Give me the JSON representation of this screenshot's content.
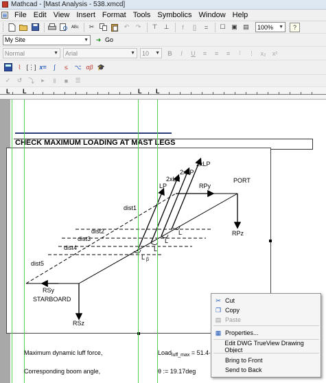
{
  "window": {
    "title": "Mathcad - [Mast Analysis - 538.xmcd]"
  },
  "menu": [
    "File",
    "Edit",
    "View",
    "Insert",
    "Format",
    "Tools",
    "Symbolics",
    "Window",
    "Help"
  ],
  "toolbar": {
    "zoom": "100%"
  },
  "resources": {
    "site": "My Site",
    "go_label": "Go"
  },
  "format_bar": {
    "style": "Normal",
    "font": "Arial",
    "size": "10",
    "bold": "B",
    "italic": "I",
    "underline": "U"
  },
  "math_bar": {
    "eval_label": "x=",
    "greek_label": "αβ"
  },
  "document": {
    "heading": "CHECK MAXIMUM LOADING AT MAST LEGS",
    "row1_text": "Maximum dynamic luff force,",
    "row2_text": "Corresponding boom angle,",
    "formula1": "Load",
    "formula1_sub": "luff_max",
    "formula1_rest": " = 51.4·",
    "formula2": "θ := 19.17deg"
  },
  "diagram": {
    "labels": {
      "port": "PORT",
      "starboard": "STARBOARD",
      "rpy": "RPy",
      "rpz": "RPz",
      "rsy": "RSy",
      "rsz": "RSz",
      "lp": "LP",
      "lp2a": "2xLP",
      "lp2b": "2xLP",
      "lp2c": "2xLP",
      "dist1": "dist1",
      "dist2": "dist2",
      "dist3": "dist3",
      "dist4": "dist4",
      "dist5": "dist5",
      "lbeta1": "L",
      "lbeta2": "L",
      "lbeta3": "L",
      "lbeta4": "L",
      "beta": "β"
    }
  },
  "context_menu": {
    "items": [
      "Cut",
      "Copy",
      "Paste",
      "Properties...",
      "Edit DWG TrueView Drawing Object",
      "Bring to Front",
      "Send to Back"
    ]
  }
}
